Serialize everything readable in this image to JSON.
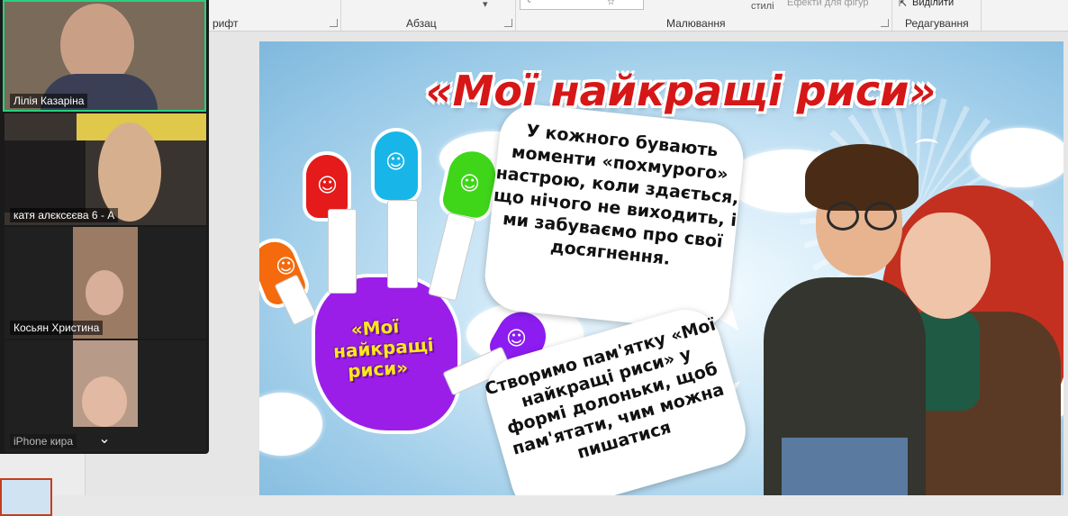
{
  "ribbon": {
    "groups": {
      "font": "рифт",
      "paragraph": "Абзац",
      "drawing": "Малювання",
      "editing": "Редагування"
    },
    "styles_label": "стилі",
    "effects_label": "Ефекти для фігур",
    "select_label": "Виділити"
  },
  "slide": {
    "title": "«Мої найкращі риси»",
    "hand_label": "«Мої найкращі риси»",
    "bubble1": "У кожного бувають моменти «похмурого» настрою, коли здається, що нічого не виходить, і ми забуваємо про свої досягнення.",
    "bubble2": "Створимо пам'ятку «Мої найкращі риси» у формі долоньки, щоб пам'ятати, чим можна пишатися",
    "colors": {
      "title": "#d61717",
      "hand": "#9b1ee8",
      "finger_orange": "#f46a0c",
      "finger_red": "#e51a1a",
      "finger_cyan": "#18b6e8",
      "finger_green": "#3fd61a",
      "finger_purple": "#8c1cf0"
    }
  },
  "zoom": {
    "participants": [
      {
        "name": "Лілія Казаріна",
        "active": true
      },
      {
        "name": "катя алєксєєва 6 - А",
        "active": false
      },
      {
        "name": "Косьян Христина",
        "active": false
      },
      {
        "name": "iPhone кира",
        "active": false
      }
    ],
    "collapse_icon": "chevron-down-icon"
  }
}
